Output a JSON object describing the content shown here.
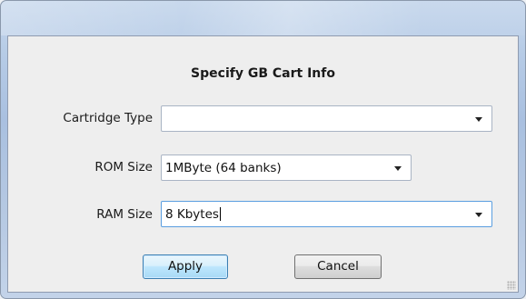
{
  "dialog": {
    "heading": "Specify GB Cart Info",
    "fields": {
      "cartridge_type": {
        "label": "Cartridge Type",
        "value": ""
      },
      "rom_size": {
        "label": "ROM Size",
        "value": "1MByte (64 banks)"
      },
      "ram_size": {
        "label": "RAM Size",
        "value": "8 Kbytes"
      }
    },
    "buttons": {
      "apply": "Apply",
      "cancel": "Cancel"
    }
  }
}
